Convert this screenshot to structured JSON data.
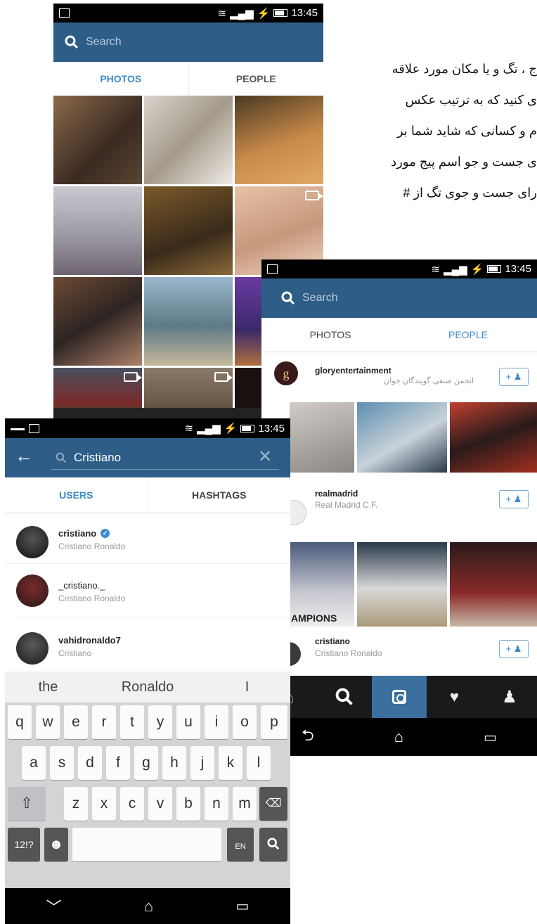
{
  "farsi_text": [
    "ج ، تگ و یا مکان مورد علاقه",
    "ی کنید که به ترتیب عکس",
    "م و کسانی که شاید شما بر",
    "ی جست و جو اسم پیج مورد",
    "رای جست و جوی تگ از #"
  ],
  "status": {
    "time": "13:45"
  },
  "screen1": {
    "search_placeholder": "Search",
    "tab_photos": "PHOTOS",
    "tab_people": "PEOPLE"
  },
  "screen2": {
    "search_placeholder": "Search",
    "tab_photos": "PHOTOS",
    "tab_people": "PEOPLE",
    "follow_label": "+ ♟",
    "people": [
      {
        "username": "gloryentertainment",
        "fullname": "انجمن صنفی گویندگان جوان"
      },
      {
        "username": "realmadrid",
        "fullname": "Real Madrid C.F."
      },
      {
        "username": "cristiano",
        "fullname": "Cristiano Ronaldo"
      }
    ],
    "realmadrid_caption": "AMPIONS"
  },
  "screen3": {
    "search_value": "Cristiano",
    "tab_users": "USERS",
    "tab_hashtags": "HASHTAGS",
    "users": [
      {
        "username": "cristiano",
        "fullname": "Cristiano Ronaldo",
        "verified": true
      },
      {
        "username": "_cristiano._",
        "fullname": "Cristiano Ronaldo"
      },
      {
        "username": "vahidronaldo7",
        "fullname": "Cristiano"
      }
    ],
    "suggestions": [
      "the",
      "Ronaldo",
      "I"
    ],
    "keyboard": {
      "row1": [
        "q",
        "w",
        "e",
        "r",
        "t",
        "y",
        "u",
        "i",
        "o",
        "p"
      ],
      "row2": [
        "a",
        "s",
        "d",
        "f",
        "g",
        "h",
        "j",
        "k",
        "l"
      ],
      "row3": [
        "z",
        "x",
        "c",
        "v",
        "b",
        "n",
        "m"
      ],
      "symbols": "12!?",
      "lang": "EN"
    }
  }
}
